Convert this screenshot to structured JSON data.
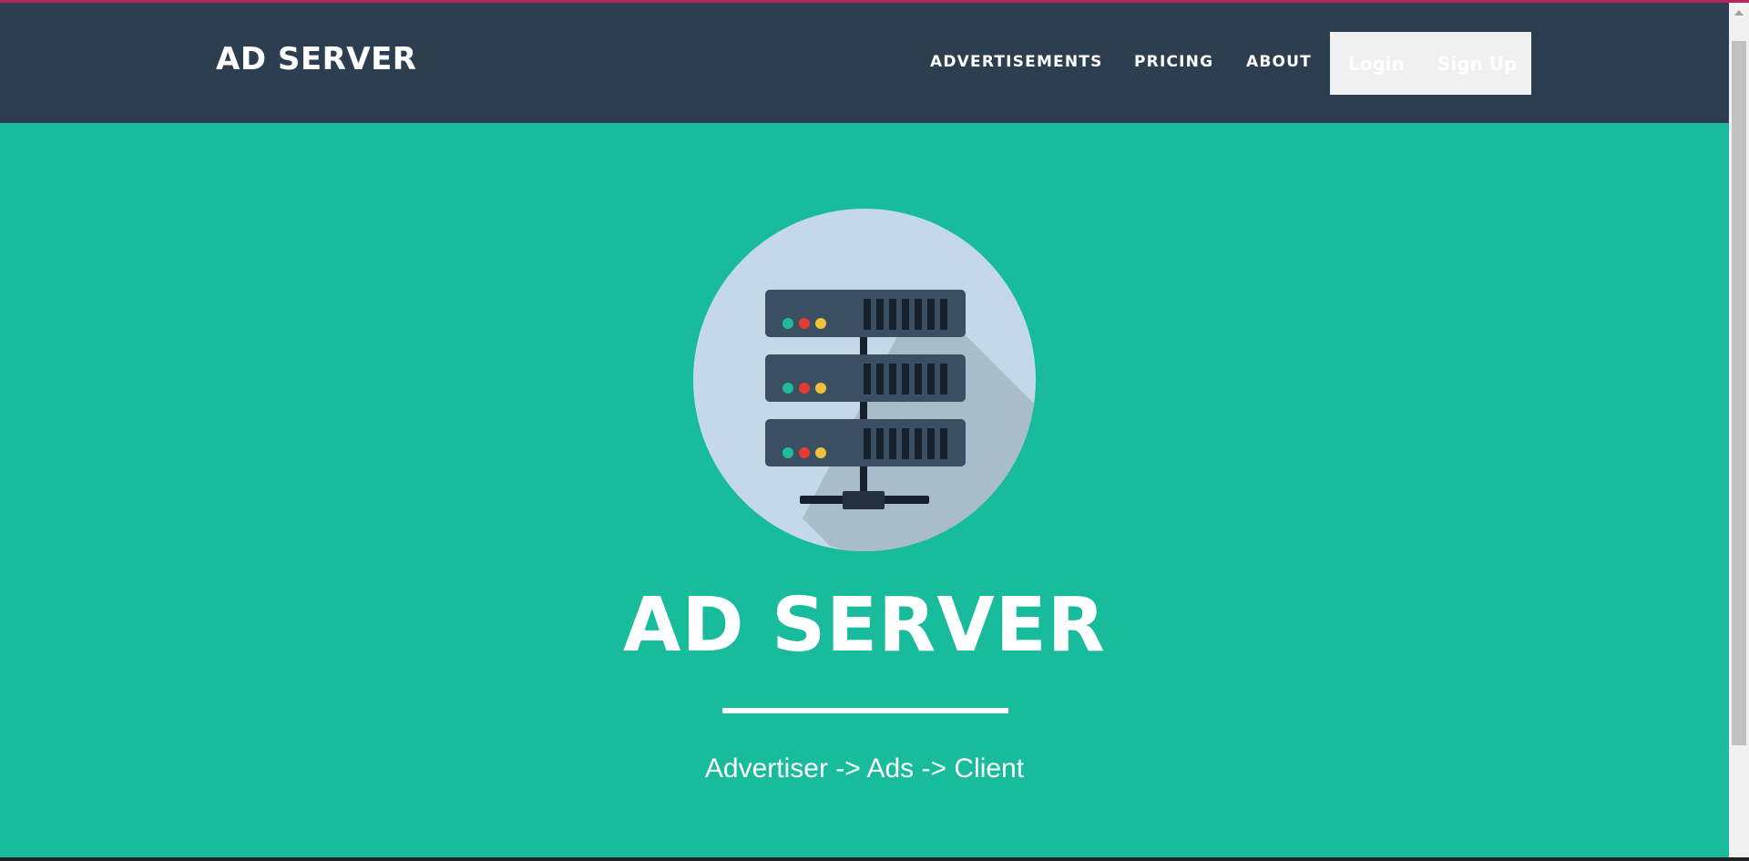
{
  "navbar": {
    "brand": "AD SERVER",
    "links": [
      "ADVERTISEMENTS",
      "PRICING",
      "ABOUT"
    ],
    "login_label": "Login",
    "signup_label": "Sign Up"
  },
  "hero": {
    "title": "AD SERVER",
    "subtitle": "Advertiser -> Ads -> Client",
    "image": "server-rack-icon"
  },
  "colors": {
    "navbar_bg": "#2c3e50",
    "hero_bg": "#18bc9c",
    "auth_box_bg": "#f0f0f0",
    "text": "#ffffff"
  }
}
